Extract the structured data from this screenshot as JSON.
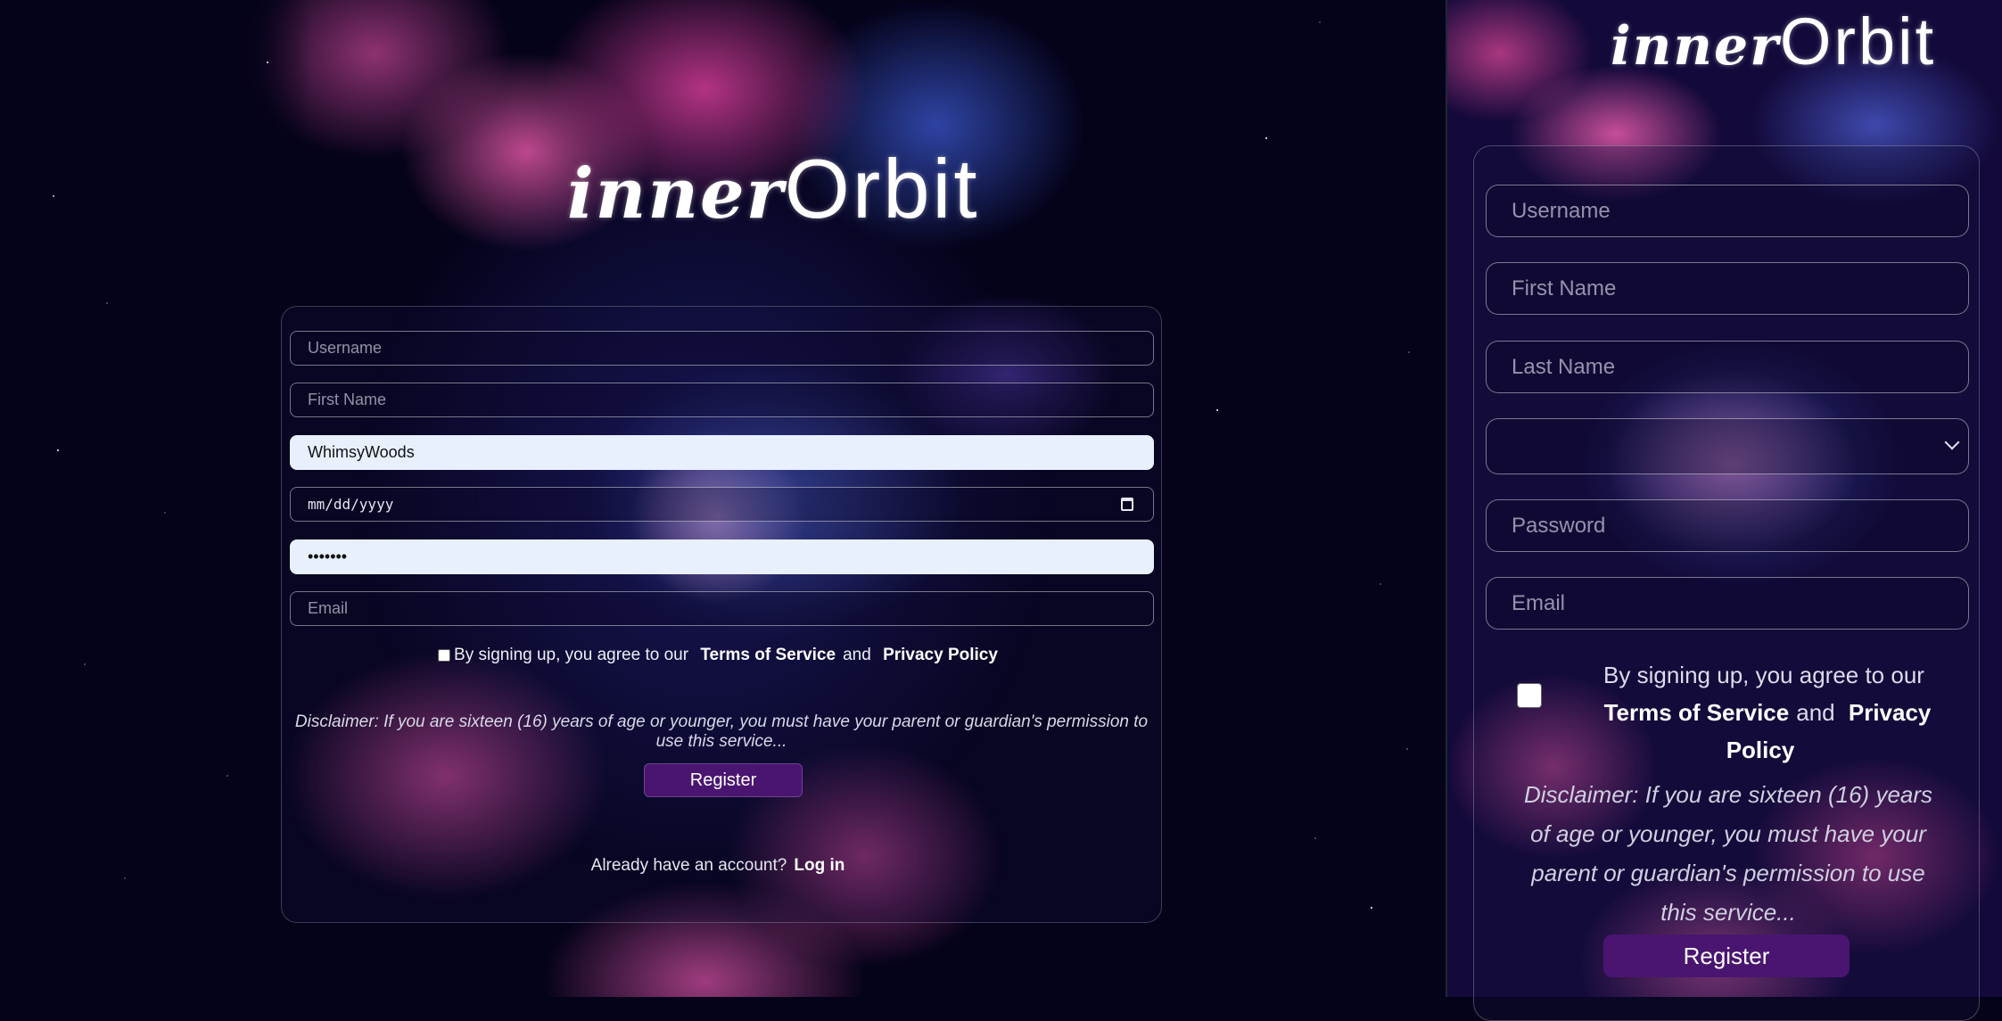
{
  "brand": {
    "script": "inner",
    "word": "Orbit"
  },
  "form": {
    "username_placeholder": "Username",
    "first_name_placeholder": "First Name",
    "last_name_value": "WhimsyWoods",
    "last_name_placeholder": "Last Name",
    "date_placeholder": "mm/dd/yyyy",
    "password_value": "•••••••",
    "password_placeholder": "Password",
    "email_placeholder": "Email",
    "select_value": ""
  },
  "terms": {
    "prefix": "By signing up, you agree to our",
    "tos": "Terms of Service",
    "and": "and",
    "privacy": "Privacy Policy"
  },
  "disclaimer": "Disclaimer: If you are sixteen (16) years of age or younger, you must have your parent or guardian's permission to use this service...",
  "register_label": "Register",
  "login": {
    "prompt": "Already have an account?",
    "link": "Log in"
  },
  "colors": {
    "accent": "#4a1570",
    "background": "#05031a",
    "autofill": "#e8f0fe"
  },
  "icons": {
    "date": "calendar-icon",
    "select": "chevron-down-icon"
  }
}
